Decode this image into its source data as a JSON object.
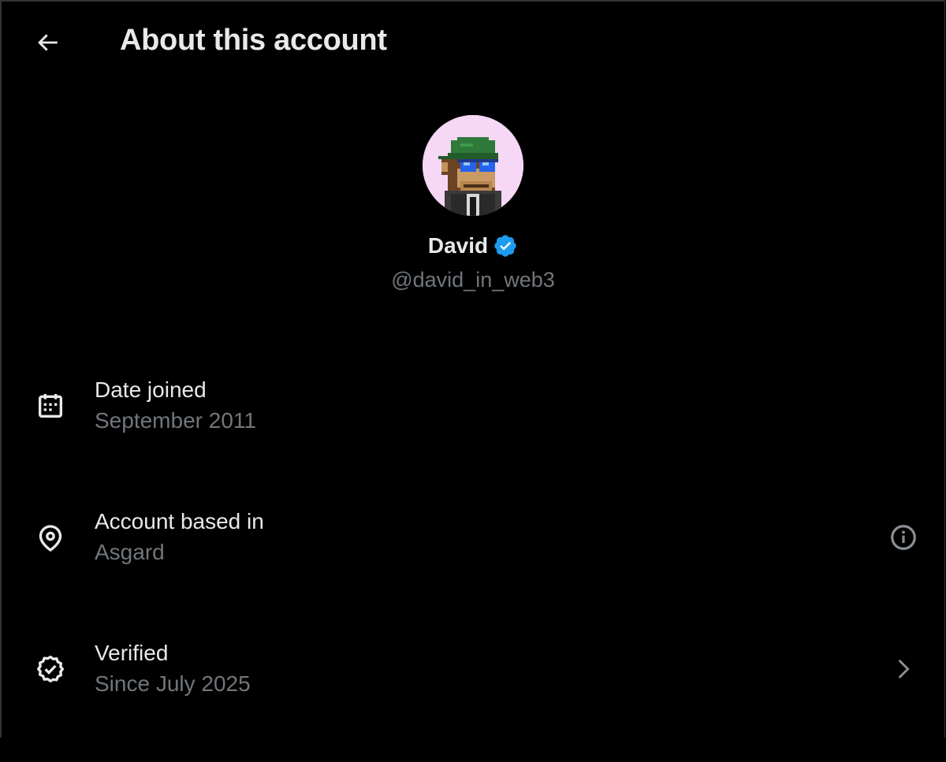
{
  "header": {
    "back_icon": "arrow-left-icon",
    "title": "About this account"
  },
  "profile": {
    "display_name": "David",
    "verified_badge_icon": "verified-badge-icon",
    "handle": "@david_in_web3",
    "avatar_bg": "#f6d7f5"
  },
  "rows": [
    {
      "icon": "calendar-icon",
      "label": "Date joined",
      "value": "September 2011"
    },
    {
      "icon": "location-pin-icon",
      "label": "Account based in",
      "value": "Asgard",
      "trailing_icon": "info-icon"
    },
    {
      "icon": "verified-check-icon",
      "label": "Verified",
      "value": "Since July 2025",
      "trailing_icon": "chevron-right-icon"
    }
  ],
  "colors": {
    "background": "#000000",
    "primary_text": "#e7e9ea",
    "secondary_text": "#71767b",
    "verified_blue": "#1d9bf0"
  }
}
